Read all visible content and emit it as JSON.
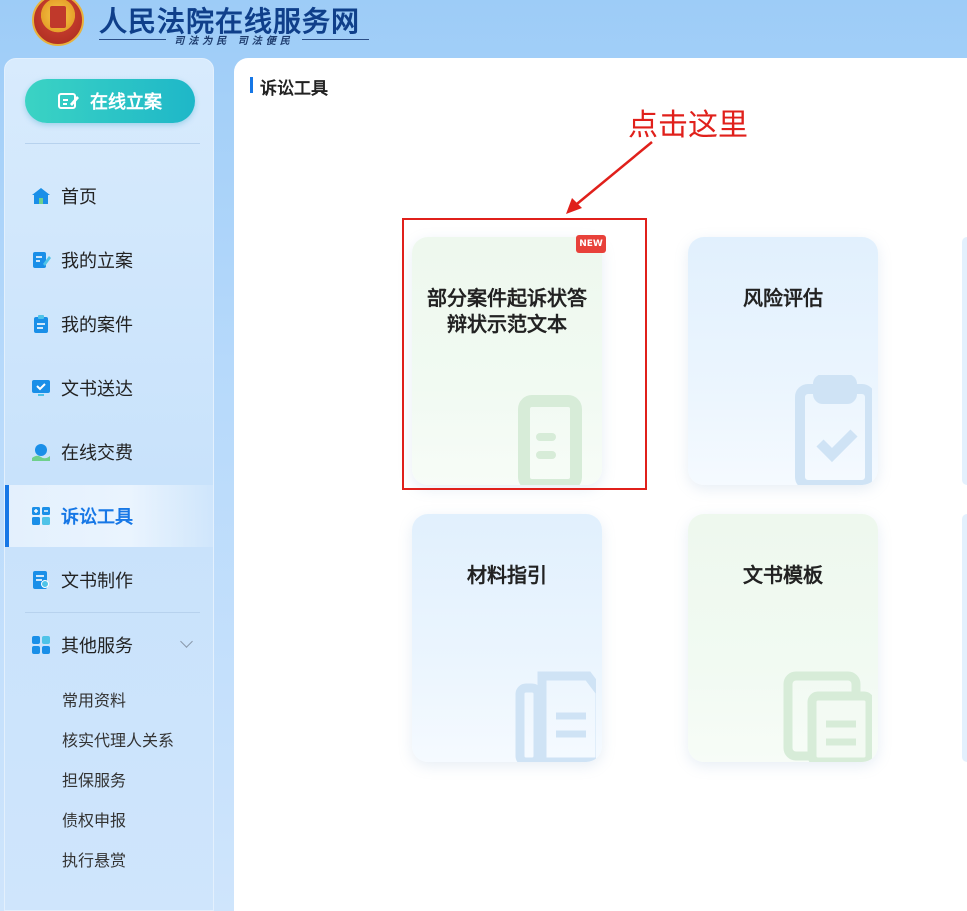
{
  "header": {
    "site_title": "人民法院在线服务网",
    "slogan": "司法为民   司法便民"
  },
  "sidebar": {
    "file_case_button": "在线立案",
    "items": [
      {
        "label": "首页",
        "icon": "home-icon"
      },
      {
        "label": "我的立案",
        "icon": "file-edit-icon"
      },
      {
        "label": "我的案件",
        "icon": "clipboard-icon"
      },
      {
        "label": "文书送达",
        "icon": "monitor-check-icon"
      },
      {
        "label": "在线交费",
        "icon": "payment-icon"
      },
      {
        "label": "诉讼工具",
        "icon": "calculator-icon",
        "active": true
      },
      {
        "label": "文书制作",
        "icon": "document-search-icon"
      },
      {
        "label": "其他服务",
        "icon": "grid-icon"
      }
    ],
    "sub_items": [
      "常用资料",
      "核实代理人关系",
      "担保服务",
      "债权申报",
      "执行悬赏"
    ]
  },
  "main": {
    "section_title": "诉讼工具",
    "cards": [
      {
        "title": "部分案件起诉状答辩状示范文本",
        "badge": "NEW",
        "icon": "book-icon"
      },
      {
        "title": "风险评估",
        "icon": "clipboard-check-icon"
      },
      {
        "title": "材料指引",
        "icon": "documents-icon"
      },
      {
        "title": "文书模板",
        "icon": "template-icon"
      }
    ],
    "annotation": "点击这里"
  },
  "colors": {
    "accent": "#1677e6",
    "annotation_red": "#e0201b",
    "file_button": "#1eb7c8",
    "header_title": "#0f3f8a"
  }
}
